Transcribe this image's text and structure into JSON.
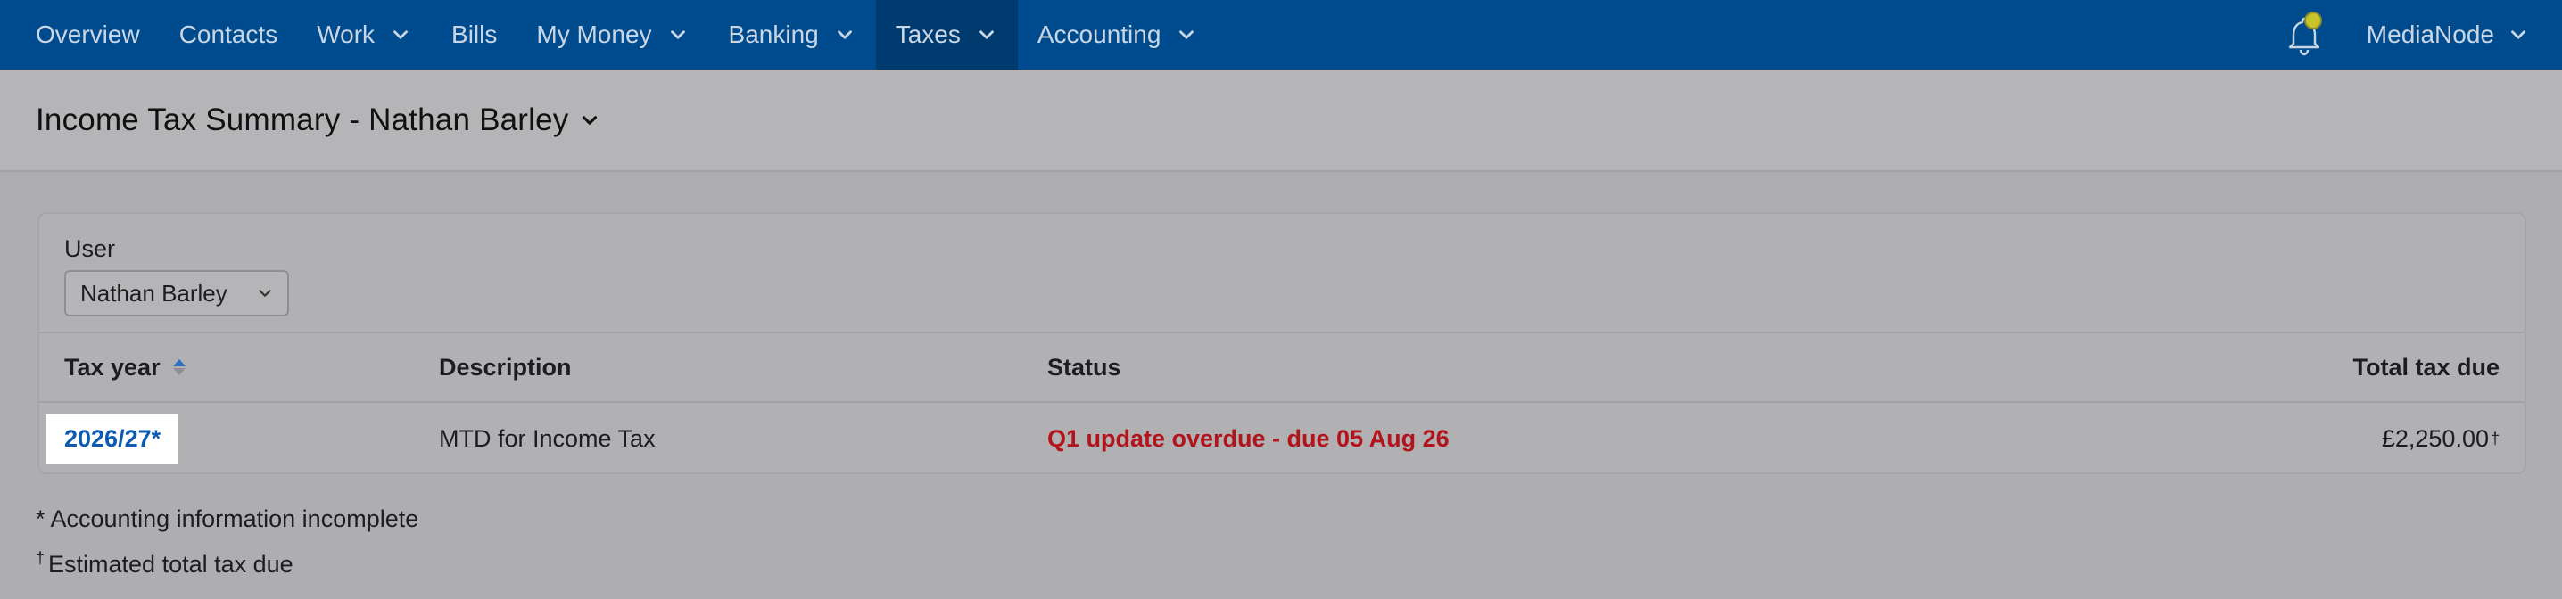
{
  "nav": {
    "items": [
      {
        "label": "Overview",
        "has_menu": false,
        "active": false
      },
      {
        "label": "Contacts",
        "has_menu": false,
        "active": false
      },
      {
        "label": "Work",
        "has_menu": true,
        "active": false
      },
      {
        "label": "Bills",
        "has_menu": false,
        "active": false
      },
      {
        "label": "My Money",
        "has_menu": true,
        "active": false
      },
      {
        "label": "Banking",
        "has_menu": true,
        "active": false
      },
      {
        "label": "Taxes",
        "has_menu": true,
        "active": true
      },
      {
        "label": "Accounting",
        "has_menu": true,
        "active": false
      }
    ],
    "account_label": "MediaNode",
    "bell_icon": "bell-icon"
  },
  "page": {
    "title": "Income Tax Summary - Nathan Barley"
  },
  "filter": {
    "user_label": "User",
    "user_value": "Nathan Barley"
  },
  "table": {
    "headers": {
      "tax_year": "Tax year",
      "description": "Description",
      "status": "Status",
      "total": "Total tax due"
    },
    "rows": [
      {
        "tax_year": "2026/27*",
        "description": "MTD for Income Tax",
        "status": "Q1 update overdue - due 05 Aug 26",
        "total": "£2,250.00",
        "total_mark": "†"
      }
    ]
  },
  "footnotes": {
    "accounting": "* Accounting information incomplete",
    "estimated_mark": "†",
    "estimated": "Estimated total tax due"
  },
  "colors": {
    "nav_bg": "#004b8d",
    "nav_active_bg": "#003b70",
    "link": "#0b5cb0",
    "overdue": "#b3141c",
    "notification_dot": "#c8c42a"
  }
}
